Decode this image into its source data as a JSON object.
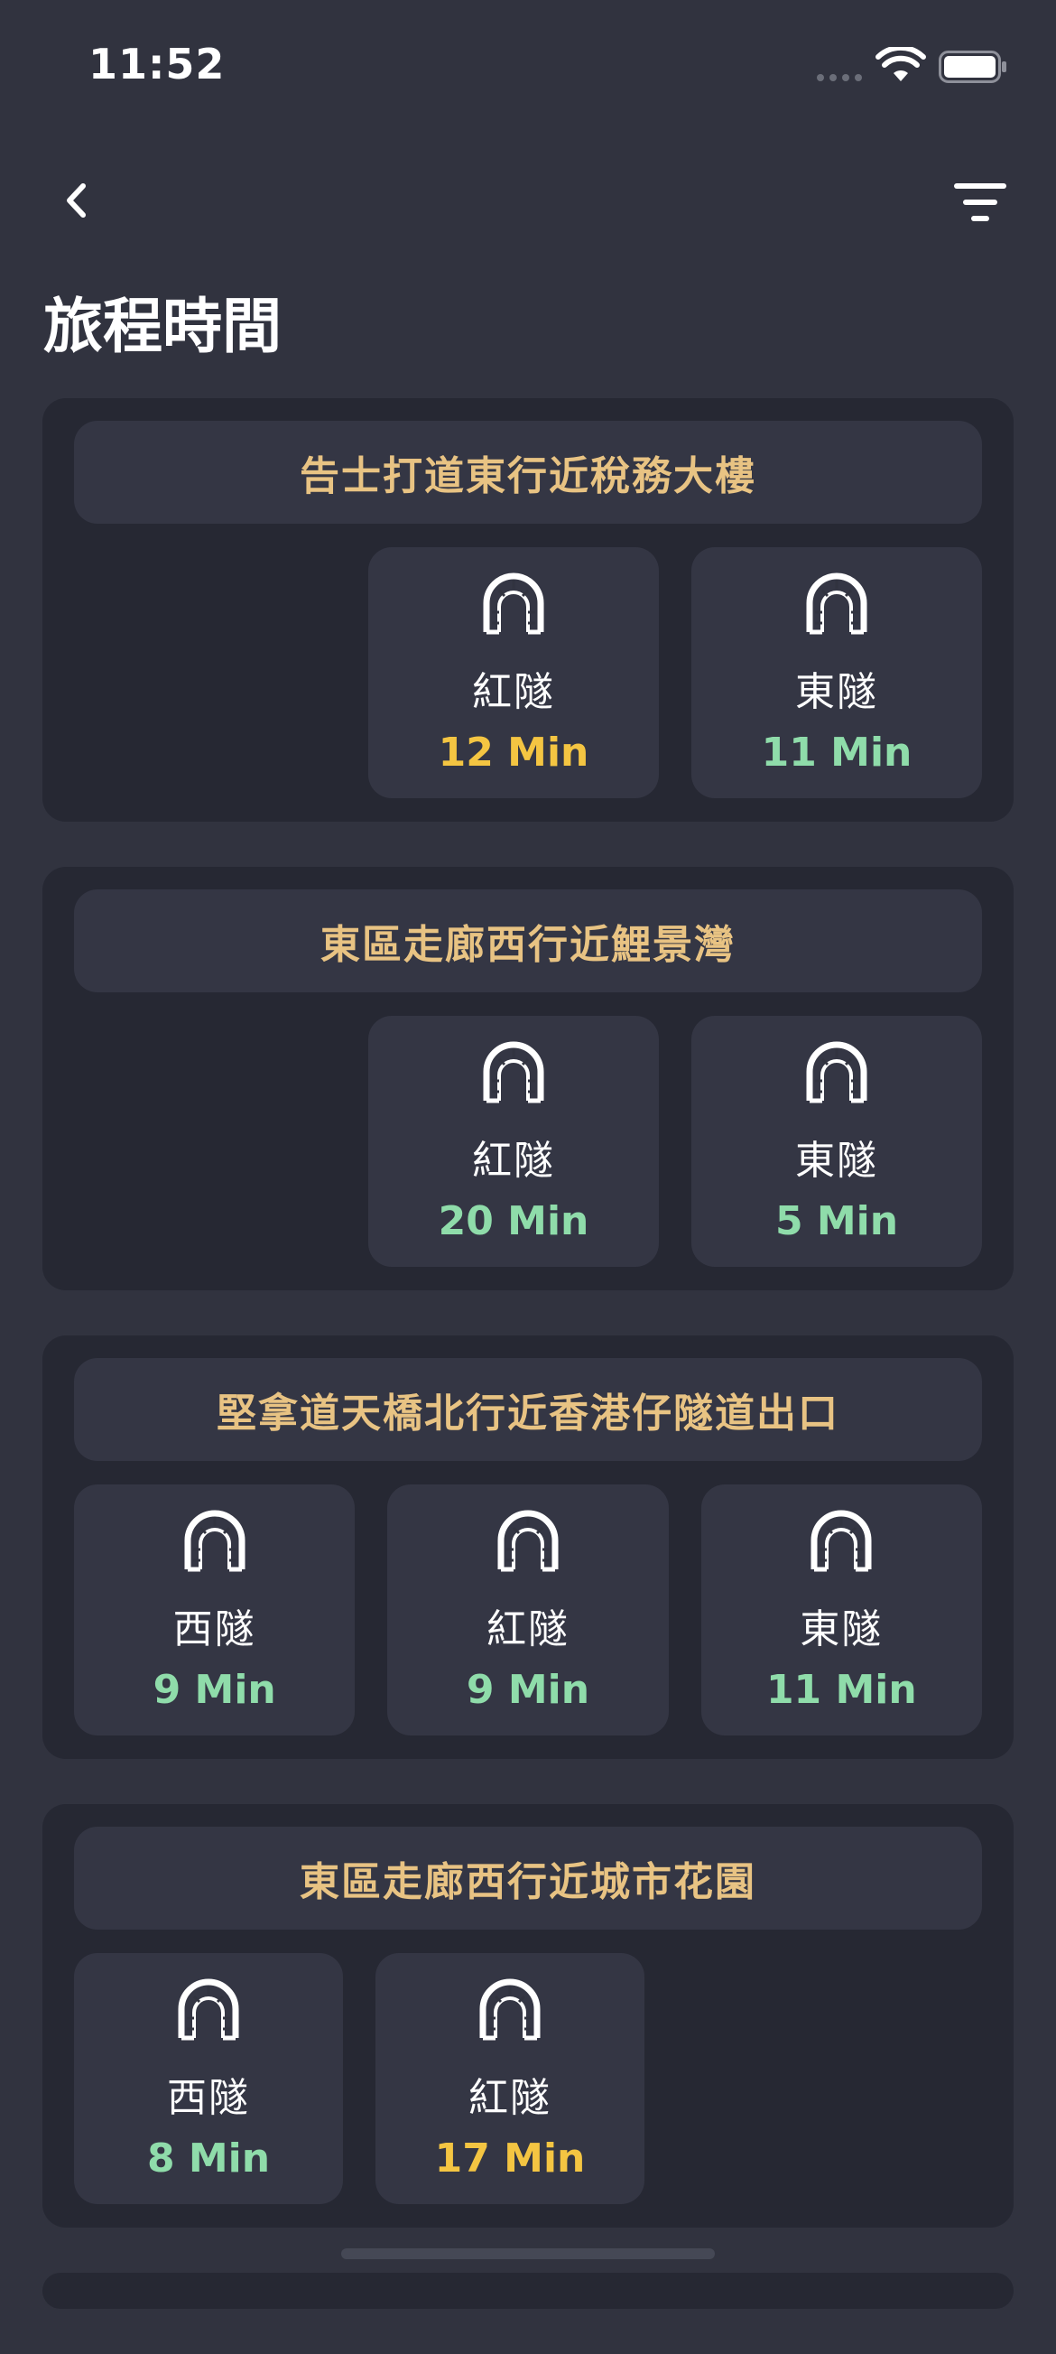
{
  "status_bar": {
    "time": "11:52"
  },
  "header": {
    "title": "旅程時間"
  },
  "colors": {
    "accent_header": "#e8c383",
    "time_green": "#8fdcaa",
    "time_yellow": "#f4c542"
  },
  "cards": [
    {
      "title": "告士打道東行近稅務大樓",
      "tunnels": [
        {
          "name": "紅隧",
          "time": "12 Min",
          "status": "yellow"
        },
        {
          "name": "東隧",
          "time": "11 Min",
          "status": "green"
        }
      ]
    },
    {
      "title": "東區走廊西行近鯉景灣",
      "tunnels": [
        {
          "name": "紅隧",
          "time": "20 Min",
          "status": "green"
        },
        {
          "name": "東隧",
          "time": "5 Min",
          "status": "green"
        }
      ]
    },
    {
      "title": "堅拿道天橋北行近香港仔隧道出口",
      "tunnels": [
        {
          "name": "西隧",
          "time": "9 Min",
          "status": "green"
        },
        {
          "name": "紅隧",
          "time": "9 Min",
          "status": "green"
        },
        {
          "name": "東隧",
          "time": "11 Min",
          "status": "green"
        }
      ]
    },
    {
      "title": "東區走廊西行近城市花園",
      "tunnels": [
        {
          "name": "西隧",
          "time": "8 Min",
          "status": "green"
        },
        {
          "name": "紅隧",
          "time": "17 Min",
          "status": "yellow"
        }
      ]
    }
  ]
}
